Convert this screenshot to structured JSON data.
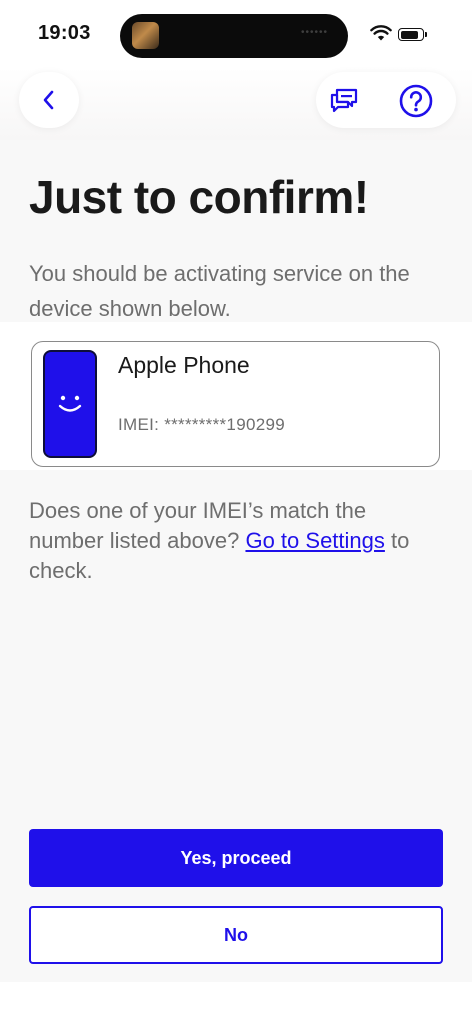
{
  "status_bar": {
    "time": "19:03",
    "island_indicator": "••••••"
  },
  "nav": {
    "back_icon": "chevron-left-icon",
    "chat_icon": "chat-bubbles-icon",
    "help_icon": "help-circle-icon"
  },
  "title": "Just to confirm!",
  "subtitle": "You should be activating service on the device shown below.",
  "device": {
    "name": "Apple Phone",
    "imei": "IMEI: *********190299"
  },
  "note": {
    "before": "Does one of your IMEI’s match the number listed above? ",
    "link": "Go to Settings",
    "after": " to check."
  },
  "actions": {
    "yes_label": "Yes, proceed",
    "no_label": "No"
  },
  "colors": {
    "accent": "#1f10ea",
    "text": "#1a1a1a",
    "muted": "#6e6e6e",
    "background": "#f8f8f8"
  }
}
